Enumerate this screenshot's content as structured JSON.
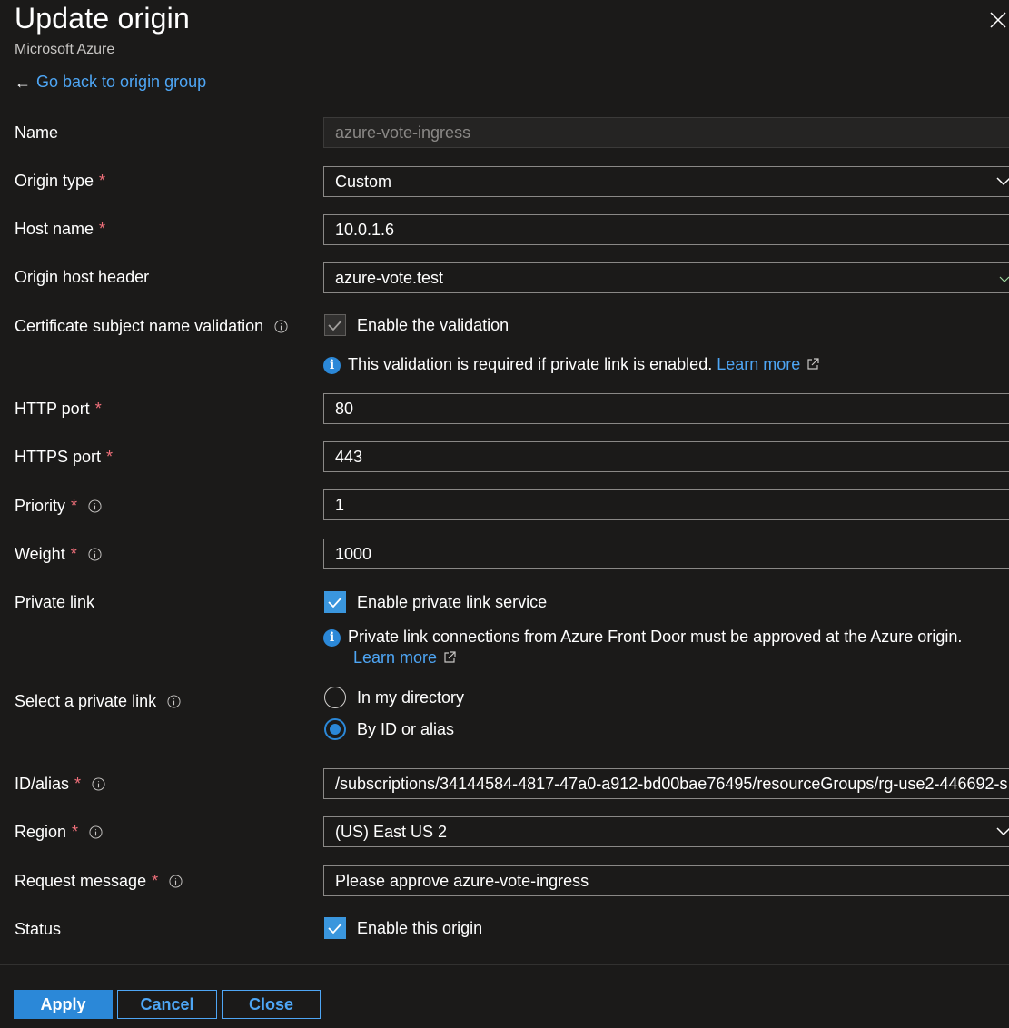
{
  "header": {
    "title": "Update origin",
    "subtitle": "Microsoft Azure",
    "back_link": "Go back to origin group"
  },
  "form": {
    "name": {
      "label": "Name",
      "value": "azure-vote-ingress"
    },
    "origin_type": {
      "label": "Origin type",
      "value": "Custom"
    },
    "host_name": {
      "label": "Host name",
      "value": "10.0.1.6"
    },
    "origin_host_header": {
      "label": "Origin host header",
      "value": "azure-vote.test"
    },
    "cert_validation": {
      "label": "Certificate subject name validation",
      "checkbox_label": "Enable the validation",
      "checked": true,
      "info_text": "This validation is required if private link is enabled.",
      "learn_more": "Learn more"
    },
    "http_port": {
      "label": "HTTP port",
      "value": "80"
    },
    "https_port": {
      "label": "HTTPS port",
      "value": "443"
    },
    "priority": {
      "label": "Priority",
      "value": "1"
    },
    "weight": {
      "label": "Weight",
      "value": "1000"
    },
    "private_link": {
      "label": "Private link",
      "checkbox_label": "Enable private link service",
      "checked": true,
      "info_text": "Private link connections from Azure Front Door must be approved at the Azure origin.",
      "learn_more": "Learn more"
    },
    "select_private_link": {
      "label": "Select a private link",
      "options": [
        "In my directory",
        "By ID or alias"
      ],
      "selected": "By ID or alias"
    },
    "id_alias": {
      "label": "ID/alias",
      "value": "/subscriptions/34144584-4817-47a0-a912-bd00bae76495/resourceGroups/rg-use2-446692-s ..."
    },
    "region": {
      "label": "Region",
      "value": "(US) East US 2"
    },
    "request_message": {
      "label": "Request message",
      "value": "Please approve azure-vote-ingress"
    },
    "status": {
      "label": "Status",
      "checkbox_label": "Enable this origin",
      "checked": true
    }
  },
  "footer": {
    "apply": "Apply",
    "cancel": "Cancel",
    "close": "Close"
  },
  "colors": {
    "background": "#1b1a19",
    "accent": "#2b88d8",
    "link": "#4ea6f5",
    "required": "#f1707b"
  }
}
